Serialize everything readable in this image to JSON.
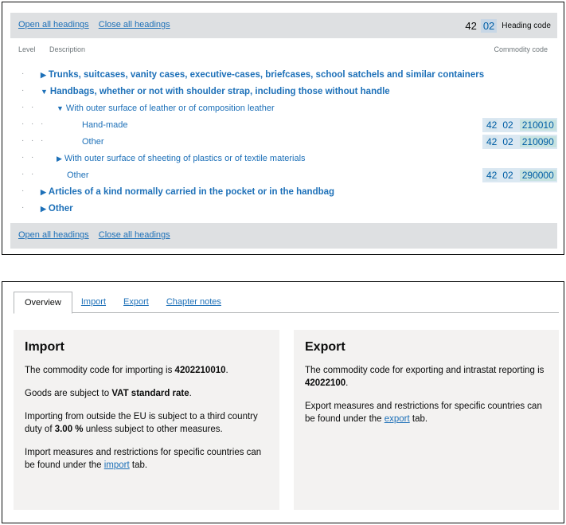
{
  "tree_panel": {
    "open_all": "Open all headings",
    "close_all": "Close all headings",
    "legend": {
      "chapter": "42",
      "heading": "02",
      "label": "Heading code"
    },
    "columns": {
      "level": "Level",
      "description": "Description",
      "code": "Commodity code"
    },
    "rows": [
      {
        "text": "Trunks, suitcases, vanity cases, executive-cases, briefcases, school satchels and similar containers",
        "arrow": "▶"
      },
      {
        "text": "Handbags, whether or not with shoulder strap, including those without handle",
        "arrow": "▼"
      },
      {
        "text": "With outer surface of leather or of composition leather",
        "arrow": "▼"
      },
      {
        "text": "Hand-made",
        "code": [
          "42",
          "02",
          "210010"
        ]
      },
      {
        "text": "Other",
        "code": [
          "42",
          "02",
          "210090"
        ]
      },
      {
        "text": "With outer surface of sheeting of plastics or of textile materials",
        "arrow": "▶"
      },
      {
        "text": "Other",
        "code": [
          "42",
          "02",
          "290000"
        ]
      },
      {
        "text": "Articles of a kind normally carried in the pocket or in the handbag",
        "arrow": "▶"
      },
      {
        "text": "Other",
        "arrow": "▶"
      }
    ],
    "dot": "·"
  },
  "overview": {
    "tabs": [
      "Overview",
      "Import",
      "Export",
      "Chapter notes"
    ],
    "import": {
      "title": "Import",
      "p1_pre": "The commodity code for importing is ",
      "p1_code": "4202210010",
      "p1_post": ".",
      "p2_pre": "Goods are subject to ",
      "p2_bold": "VAT standard rate",
      "p2_post": ".",
      "p3_pre": "Importing from outside the EU is subject to a third country duty of ",
      "p3_bold": "3.00 %",
      "p3_post": " unless subject to other measures.",
      "p4_pre": "Import measures and restrictions for specific countries can be found under the ",
      "p4_link": "import",
      "p4_post": " tab."
    },
    "export": {
      "title": "Export",
      "p1_pre": "The commodity code for exporting and intrastat reporting is ",
      "p1_code": "42022100",
      "p1_post": ".",
      "p2_pre": "Export measures and restrictions for specific countries can be found under the ",
      "p2_link": "export",
      "p2_post": " tab."
    }
  }
}
